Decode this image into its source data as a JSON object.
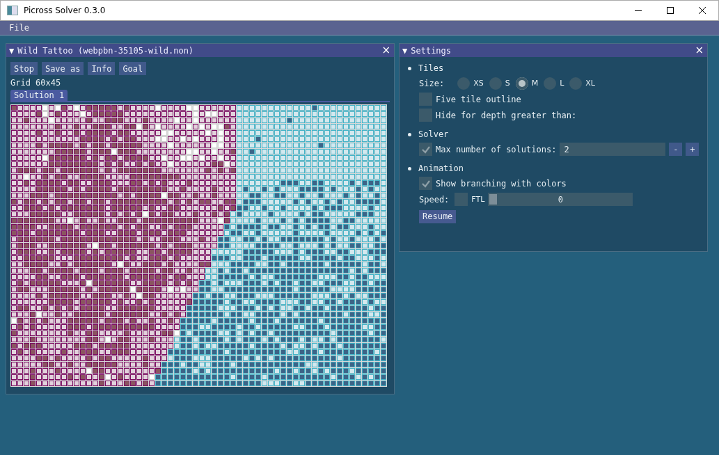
{
  "window": {
    "title": "Picross Solver 0.3.0"
  },
  "menu": [
    {
      "label": "File"
    }
  ],
  "puzzle_window": {
    "toggle": "▼",
    "title": "Wild Tattoo (webpbn-35105-wild.non)",
    "close": "×",
    "buttons": [
      "Stop",
      "Save as",
      "Info",
      "Goal"
    ],
    "grid_label": "Grid 60x45",
    "tabs": [
      {
        "label": "Solution 1",
        "selected": true
      }
    ]
  },
  "settings_window": {
    "toggle": "▼",
    "title": "Settings",
    "close": "×",
    "sections": [
      {
        "label": "Tiles",
        "items": [
          {
            "kind": "radio",
            "label": "Size:",
            "options": [
              {
                "label": "XS",
                "selected": false
              },
              {
                "label": "S",
                "selected": false
              },
              {
                "label": "M",
                "selected": true
              },
              {
                "label": "L",
                "selected": false
              },
              {
                "label": "XL",
                "selected": false
              }
            ]
          },
          {
            "kind": "checkbox",
            "label": "Five tile outline",
            "checked": false
          },
          {
            "kind": "checkbox",
            "label": "Hide for depth greater than:",
            "checked": false
          }
        ]
      },
      {
        "label": "Solver",
        "items": [
          {
            "kind": "number",
            "label": "Max number of solutions:",
            "checked": true,
            "value": "2",
            "minus": "-",
            "plus": "+"
          }
        ]
      },
      {
        "label": "Animation",
        "items": [
          {
            "kind": "checkbox",
            "label": "Show branching with colors",
            "checked": true
          },
          {
            "kind": "speed",
            "label": "Speed:",
            "option": "FTL",
            "checked": false,
            "level": 0,
            "reading": "0"
          },
          {
            "kind": "button",
            "label": "Resume"
          }
        ]
      }
    ]
  }
}
